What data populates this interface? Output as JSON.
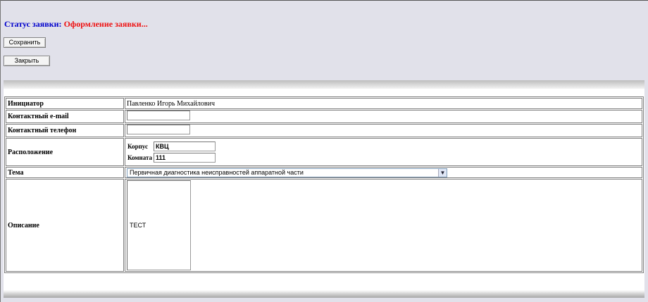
{
  "status": {
    "label": "Статус заявки:",
    "value": "Оформление заявки..."
  },
  "buttons": {
    "save": "Сохранить",
    "close": "Закрыть"
  },
  "form": {
    "initiator": {
      "label": "Инициатор",
      "value": "Павленко Игорь Михайлович"
    },
    "email": {
      "label": "Контактный e-mail",
      "value": ""
    },
    "phone": {
      "label": "Контактный телефон",
      "value": ""
    },
    "location": {
      "label": "Расположение",
      "building_label": "Корпус",
      "building_value": "КВЦ",
      "room_label": "Комната",
      "room_value": "111"
    },
    "topic": {
      "label": "Тема",
      "value": "Первичная диагностика неисправностей аппаратной части"
    },
    "description": {
      "label": "Описание",
      "value": "ТЕСТ"
    }
  },
  "icons": {
    "dropdown": "chevron-down-icon"
  },
  "colors": {
    "status_label": "#0000cc",
    "status_value": "#ee1111",
    "background": "#e1e1ea"
  }
}
